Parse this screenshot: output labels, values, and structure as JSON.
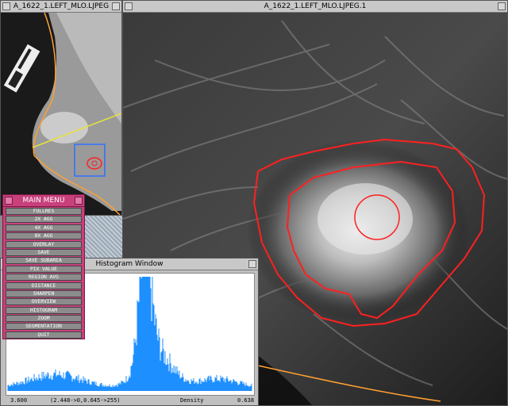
{
  "overview_window": {
    "title": "A_1622_1.LEFT_MLO.LJPEG"
  },
  "main_window": {
    "title": "A_1622_1.LEFT_MLO.LJPEG.1"
  },
  "main_menu": {
    "title": "MAIN MENU",
    "items": [
      "FULLRES",
      "2X AGG",
      "4X AGG",
      "8X AGG",
      "OVERLAY",
      "SAVE",
      "SAVE SUBAREA",
      "PIX VALUE",
      "REGION AVG",
      "DISTANCE",
      "SHARPEN",
      "OVERVIEW",
      "HISTOGRAM",
      "ZOOM",
      "SEGMENTATION",
      "QUIT"
    ]
  },
  "histogram_window": {
    "title": "Histogram Window",
    "min_label": "3.600",
    "range_label": "(2.448->0,0.645->255)",
    "axis_label": "Density",
    "max_label": "0.638",
    "bar_color": "#1e8fff"
  },
  "overlay_colors": {
    "contour": "#ff2020",
    "boundary": "#ffa030",
    "roi_box": "#2f6fff",
    "line": "#e8e040"
  }
}
